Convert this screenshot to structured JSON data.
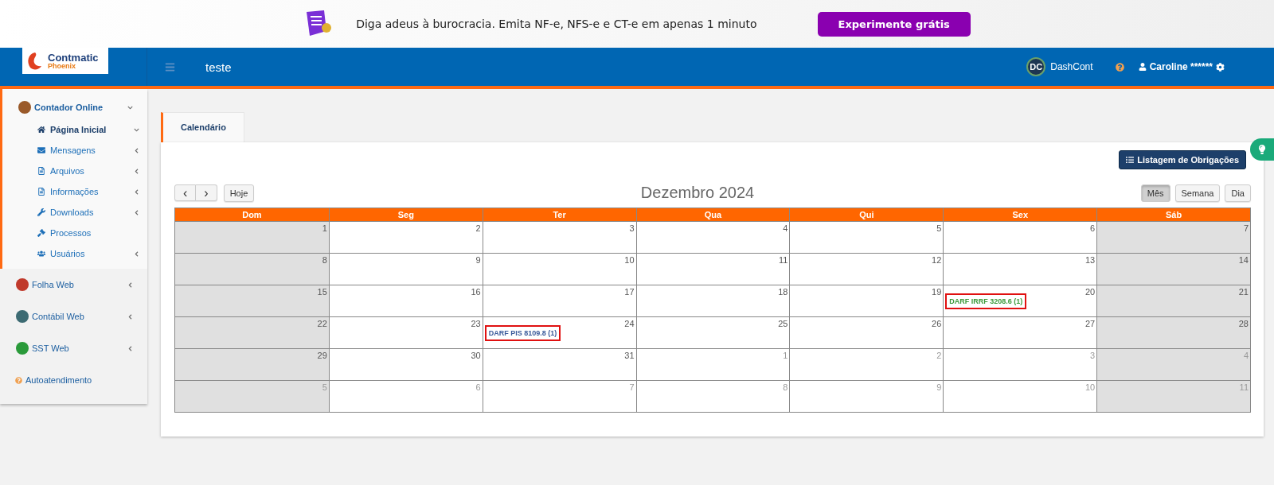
{
  "banner": {
    "text": "Diga adeus à burocracia. Emita NF-e, NFS-e e CT-e em apenas 1 minuto",
    "button": "Experimente grátis"
  },
  "header": {
    "logo_name": "Contmatic",
    "logo_sub": "Phoenix",
    "title": "teste",
    "badge": "DC",
    "dashcont": "DashCont",
    "user": "Caroline ******"
  },
  "sidebar": {
    "items": [
      {
        "label": "Contador Online",
        "expanded": true,
        "children": [
          {
            "label": "Página Inicial",
            "selected": true,
            "expanded": true
          },
          {
            "label": "Mensagens",
            "selected": false,
            "expanded": false
          },
          {
            "label": "Arquivos",
            "selected": false,
            "expanded": false
          },
          {
            "label": "Informações",
            "selected": false,
            "expanded": false
          },
          {
            "label": "Downloads",
            "selected": false,
            "expanded": false
          },
          {
            "label": "Processos",
            "selected": false
          },
          {
            "label": "Usuários",
            "selected": false,
            "expanded": false
          }
        ]
      },
      {
        "label": "Folha Web",
        "expanded": false,
        "color": "#c0392b"
      },
      {
        "label": "Contábil Web",
        "expanded": false,
        "color": "#3d6b73"
      },
      {
        "label": "SST Web",
        "expanded": false,
        "color": "#2a9a3a"
      },
      {
        "label": "Autoatendimento",
        "kind": "help"
      }
    ]
  },
  "tabs": [
    {
      "label": "Calendário",
      "selected": true
    }
  ],
  "calendar": {
    "list_button": "Listagem de Obrigações",
    "prev": "‹",
    "next": "›",
    "today": "Hoje",
    "title": "Dezembro 2024",
    "views": [
      {
        "label": "Mês",
        "selected": true
      },
      {
        "label": "Semana",
        "selected": false
      },
      {
        "label": "Dia",
        "selected": false
      }
    ],
    "weekdays": [
      "Dom",
      "Seg",
      "Ter",
      "Qua",
      "Qui",
      "Sex",
      "Sáb"
    ],
    "weeks": [
      [
        {
          "day": "1",
          "other_month": false
        },
        {
          "day": "2",
          "other_month": false
        },
        {
          "day": "3",
          "other_month": false
        },
        {
          "day": "4",
          "other_month": false
        },
        {
          "day": "5",
          "other_month": false
        },
        {
          "day": "6",
          "other_month": false
        },
        {
          "day": "7",
          "other_month": false
        }
      ],
      [
        {
          "day": "8",
          "other_month": false
        },
        {
          "day": "9",
          "other_month": false
        },
        {
          "day": "10",
          "other_month": false
        },
        {
          "day": "11",
          "other_month": false
        },
        {
          "day": "12",
          "other_month": false
        },
        {
          "day": "13",
          "other_month": false
        },
        {
          "day": "14",
          "other_month": false
        }
      ],
      [
        {
          "day": "15",
          "other_month": false
        },
        {
          "day": "16",
          "other_month": false
        },
        {
          "day": "17",
          "other_month": false
        },
        {
          "day": "18",
          "other_month": false
        },
        {
          "day": "19",
          "other_month": false
        },
        {
          "day": "20",
          "other_month": false,
          "events": [
            {
              "text": "DARF IRRF 3208.6 (1)",
              "color": "#3a9a3a",
              "highlighted": true
            }
          ]
        },
        {
          "day": "21",
          "other_month": false
        }
      ],
      [
        {
          "day": "22",
          "other_month": false
        },
        {
          "day": "23",
          "other_month": false
        },
        {
          "day": "24",
          "other_month": false,
          "events": [
            {
              "text": "DARF PIS 8109.8 (1)",
              "color": "#3a5a9a",
              "highlighted": true
            }
          ]
        },
        {
          "day": "25",
          "other_month": false
        },
        {
          "day": "26",
          "other_month": false
        },
        {
          "day": "27",
          "other_month": false
        },
        {
          "day": "28",
          "other_month": false
        }
      ],
      [
        {
          "day": "29",
          "other_month": false
        },
        {
          "day": "30",
          "other_month": false
        },
        {
          "day": "31",
          "other_month": false
        },
        {
          "day": "1",
          "other_month": true
        },
        {
          "day": "2",
          "other_month": true
        },
        {
          "day": "3",
          "other_month": true
        },
        {
          "day": "4",
          "other_month": true
        }
      ],
      [
        {
          "day": "5",
          "other_month": true
        },
        {
          "day": "6",
          "other_month": true
        },
        {
          "day": "7",
          "other_month": true
        },
        {
          "day": "8",
          "other_month": true
        },
        {
          "day": "9",
          "other_month": true
        },
        {
          "day": "10",
          "other_month": true
        },
        {
          "day": "11",
          "other_month": true
        }
      ]
    ]
  }
}
